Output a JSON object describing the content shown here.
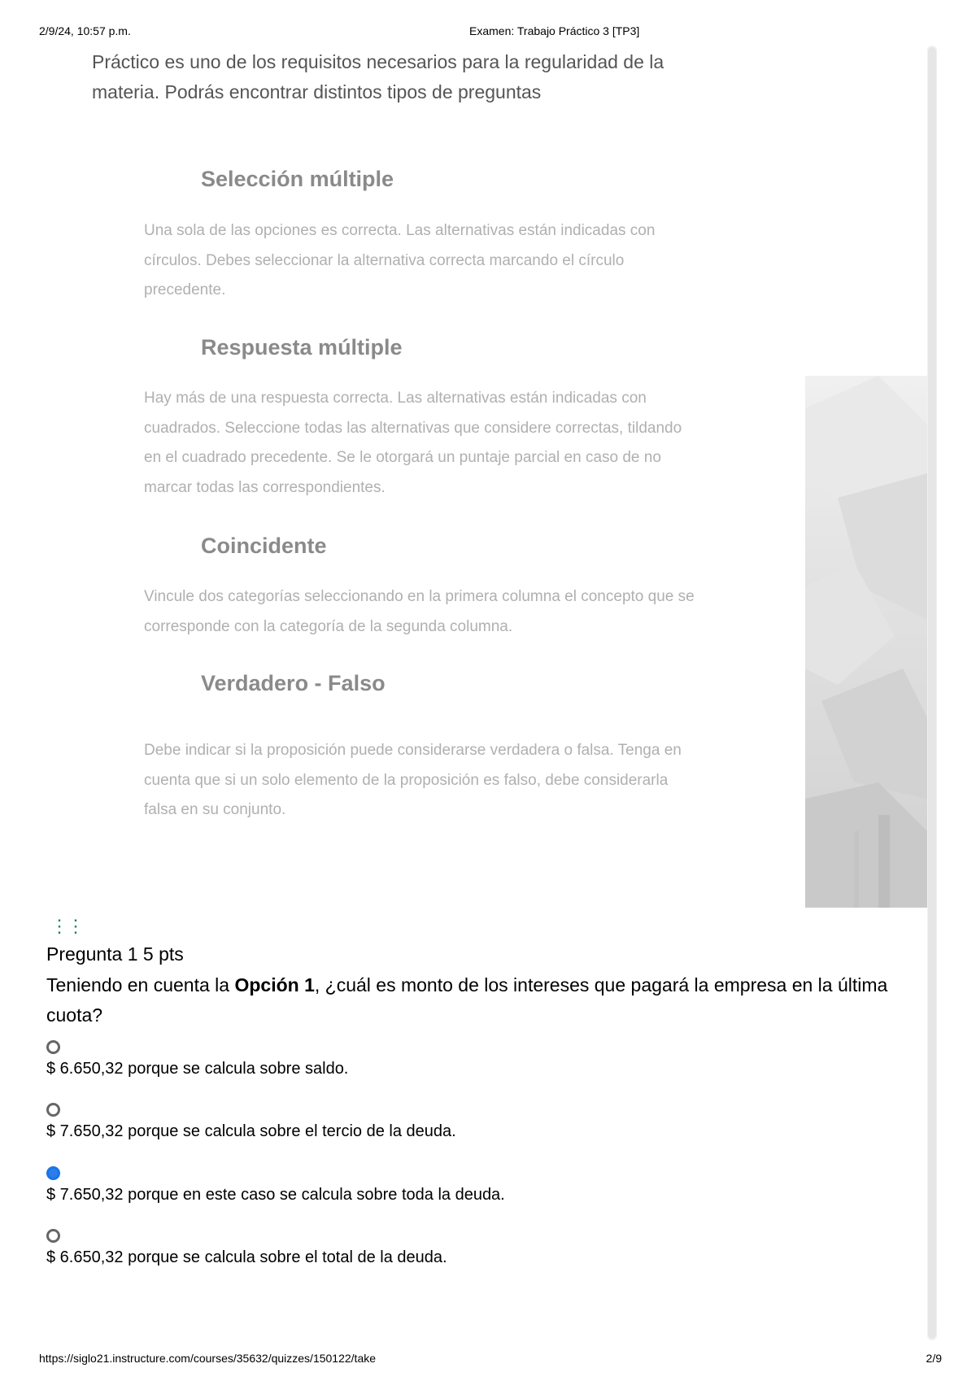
{
  "print_header": {
    "datetime": "2/9/24, 10:57 p.m.",
    "title": "Examen: Trabajo Práctico 3 [TP3]"
  },
  "print_footer": {
    "url": "https://siglo21.instructure.com/courses/35632/quizzes/150122/take",
    "page": "2/9"
  },
  "intro_text": "Práctico es uno de los requisitos necesarios para la regularidad de la materia. Podrás encontrar distintos tipos de preguntas",
  "sections": [
    {
      "title": "Selección múltiple",
      "text": "Una sola de las opciones es correcta. Las alternativas están indicadas con círculos. Debes seleccionar la alternativa correcta marcando el círculo precedente."
    },
    {
      "title": "Respuesta múltiple",
      "text": "Hay más de una respuesta correcta. Las alternativas están indicadas con cuadrados. Seleccione todas las alternativas que considere correctas, tildando en el cuadrado precedente. Se le otorgará un puntaje parcial en caso de no marcar todas las correspondientes."
    },
    {
      "title": "Coincidente",
      "text": "Vincule dos categorías seleccionando en la primera columna el concepto que se corresponde con la categoría de la segunda columna."
    },
    {
      "title": "Verdadero - Falso",
      "text": "Debe indicar si la proposición puede considerarse verdadera o falsa. Tenga en cuenta que si un solo elemento de la proposición es falso, debe considerarla falsa en su conjunto."
    }
  ],
  "question": {
    "header": "Pregunta 1 5 pts",
    "text_before": "Teniendo en cuenta la ",
    "text_bold": "Opción 1",
    "text_after": ", ¿cuál es monto de los intereses que pagará la empresa en la última cuota?",
    "answers": [
      {
        "label": "$ 6.650,32 porque se calcula sobre saldo.",
        "selected": false
      },
      {
        "label": "$ 7.650,32 porque se calcula sobre el tercio de la deuda.",
        "selected": false
      },
      {
        "label": "$ 7.650,32 porque en este caso se calcula sobre toda la deuda.",
        "selected": true
      },
      {
        "label": "$ 6.650,32 porque se calcula sobre el total de la deuda.",
        "selected": false
      }
    ]
  },
  "colors": {
    "selected_radio": "#2b7de9",
    "drag_handle": "#0b874b"
  }
}
